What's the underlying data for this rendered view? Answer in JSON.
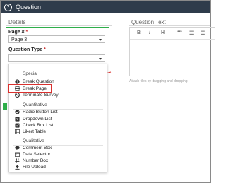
{
  "header": {
    "title": "Question"
  },
  "details": {
    "title": "Details"
  },
  "question_text": {
    "title": "Question Text",
    "toolbar": [
      "B",
      "I",
      "H",
      "““",
      "☰",
      "☰"
    ],
    "attach_hint": "Attach files by dragging and dropping"
  },
  "page_field": {
    "label": "Page #",
    "required_mark": "*",
    "value": "Page 3"
  },
  "question_type": {
    "label": "Question Type",
    "required_mark": "*",
    "value": ""
  },
  "menu": {
    "special": {
      "label": "Special",
      "items": [
        "Break Question",
        "Break Page",
        "Terminate Survey"
      ]
    },
    "quantitative": {
      "label": "Quantitative",
      "items": [
        "Radio Button List",
        "Dropdown List",
        "Check Box List",
        "Likert Table"
      ]
    },
    "qualitative": {
      "label": "Qualitative",
      "items": [
        "Comment Box",
        "Date Selector",
        "Number Box",
        "File Upload"
      ]
    }
  },
  "colors": {
    "header_bg": "#2f3c4b",
    "highlight": "#d9312e",
    "focus_green": "#2eae4a"
  }
}
